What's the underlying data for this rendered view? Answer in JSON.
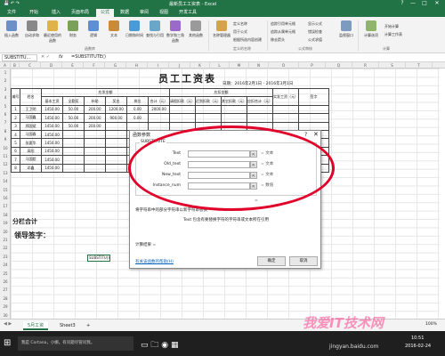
{
  "window": {
    "title": "最新员工工资表 - Excel",
    "quick_access": "",
    "controls": [
      "?",
      "—",
      "□",
      "✕"
    ]
  },
  "tabs": [
    "文件",
    "开始",
    "插入",
    "页面布局",
    "公式",
    "数据",
    "审阅",
    "视图",
    "开发工具"
  ],
  "active_tab_index": 4,
  "ribbon": {
    "buttons": [
      "插入函数",
      "自动求和",
      "最近使用的函数",
      "财务",
      "逻辑",
      "文本",
      "日期和时间",
      "查找与引用",
      "数学和三角函数",
      "其他函数",
      "名称管理器",
      "计算选项"
    ],
    "small": [
      "定义名称",
      "用于公式",
      "根据所选内容创建",
      "追踪引用单元格",
      "追踪从属单元格",
      "移去箭头",
      "显示公式",
      "错误检查",
      "公式求值",
      "监视窗口",
      "开始计算",
      "计算工作表"
    ],
    "groups": [
      "函数库",
      "定义的名称",
      "公式审核",
      "计算"
    ]
  },
  "formula_bar": {
    "name_box": "SUBSTITU...",
    "fx": "fx",
    "formula": "=SUBSTITUTE()"
  },
  "columns": [
    "A",
    "B",
    "C",
    "D",
    "E",
    "F",
    "G",
    "H",
    "I",
    "J",
    "K",
    "L",
    "M",
    "N",
    "O",
    "P",
    "Q",
    "R",
    "S",
    "T"
  ],
  "rows": [
    "1",
    "2",
    "3",
    "4",
    "5",
    "6",
    "7",
    "8",
    "9",
    "10",
    "11",
    "12",
    "13",
    "14",
    "15",
    "16",
    "17",
    "18",
    "19",
    "20",
    "21",
    "22",
    "23",
    "24",
    "25",
    "26",
    "27",
    "28",
    "29",
    "30"
  ],
  "sheet": {
    "title": "员工工资表",
    "date": "日期：2016年2月1日 - 2016年3月1日",
    "header1": [
      "编号",
      "姓名",
      "应发金额",
      "",
      "",
      "",
      "应扣金额",
      "",
      "",
      "",
      "实发工资（元）",
      "签字"
    ],
    "header2": [
      "基本工资",
      "全勤奖",
      "补助",
      "奖金",
      "岗位",
      "合计（元）",
      "请假扣款（元）",
      "迟到扣款（元）",
      "其它扣款（元）",
      "应扣合计（元）"
    ],
    "rows": [
      [
        "1",
        "王卫明",
        "1450.00",
        "50.00",
        "200.00",
        "1200.00",
        "0.00",
        "2000.00",
        "",
        "",
        "",
        "",
        "",
        ""
      ],
      [
        "2",
        "马国鑫",
        "1450.00",
        "50.00",
        "200.00",
        "900.00",
        "0.00",
        "",
        "",
        "",
        "",
        "",
        "",
        ""
      ],
      [
        "3",
        "郑国斌",
        "1450.00",
        "50.00",
        "200.00",
        "",
        "",
        "",
        "",
        "",
        "",
        "",
        "",
        ""
      ],
      [
        "4",
        "马国春",
        "1450.00",
        "",
        "",
        "",
        "",
        "",
        "",
        "",
        "",
        "",
        "",
        ""
      ],
      [
        "5",
        "张要华",
        "1450.00",
        "",
        "",
        "",
        "",
        "",
        "",
        "",
        "",
        "",
        "",
        ""
      ],
      [
        "6",
        "高阳",
        "1450.00",
        "",
        "",
        "",
        "",
        "",
        "",
        "",
        "",
        "",
        "",
        ""
      ],
      [
        "7",
        "马国超",
        "1450.00",
        "",
        "",
        "",
        "",
        "",
        "",
        "",
        "",
        "",
        "",
        ""
      ],
      [
        "8",
        "邓鑫",
        "1450.00",
        "",
        "",
        "",
        "",
        "",
        "",
        "",
        "",
        "",
        "",
        ""
      ]
    ],
    "subtotal": "分栏合计",
    "sign": "领导签字：",
    "active_cell": "SUBSTITU()"
  },
  "dialog": {
    "title": "函数参数",
    "help": "?",
    "close": "✕",
    "function_name": "SUBSTITUTE",
    "args": [
      {
        "label": "Text",
        "value": "",
        "result": "= 文本"
      },
      {
        "label": "Old_text",
        "value": "",
        "result": "= 文本"
      },
      {
        "label": "New_text",
        "value": "",
        "result": "= 文本"
      },
      {
        "label": "Instance_num",
        "value": "",
        "result": "= 数值"
      }
    ],
    "result_eq": "=",
    "description": "将字符串中的部分字符串以新字符串替换",
    "arg_help": "Text  包含有要替换字符的字符串或文本所在引用",
    "calc_result": "计算结果 =",
    "help_link": "有关该函数的帮助(H)",
    "ok": "确定",
    "cancel": "取消"
  },
  "status": {
    "tabs": [
      "5月工资",
      "Sheet3"
    ],
    "add": "+",
    "zoom": "100%"
  },
  "taskbar": {
    "search": "我是 Cortana，小娜。有问题尽管问我。",
    "time": "10:51",
    "date": "2016-02-24"
  },
  "watermark": {
    "text": "我爱IT技术网",
    "sub": "jingyan.baidu.com"
  },
  "colors": {
    "excel_green": "#217346",
    "highlight": "#e0002a"
  }
}
